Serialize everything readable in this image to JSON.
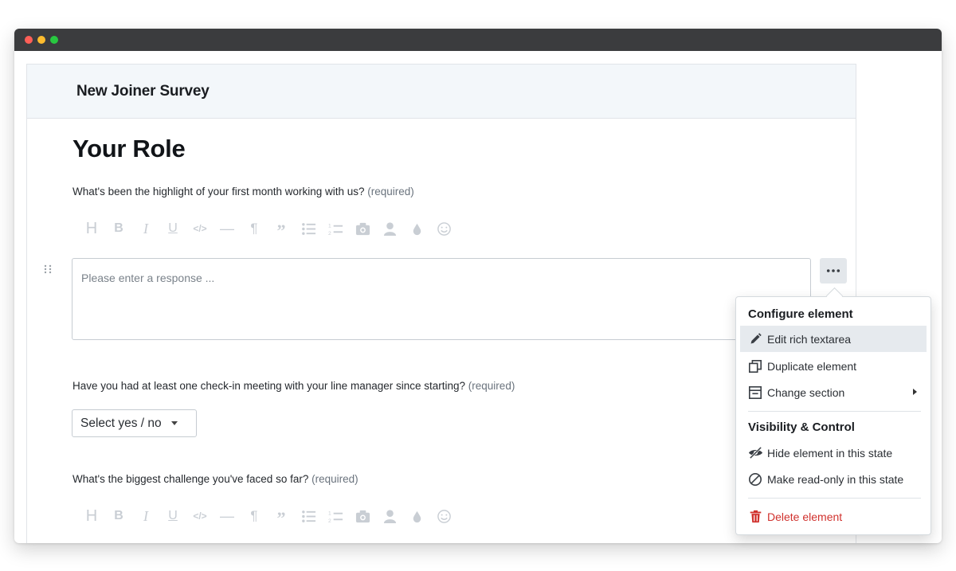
{
  "window": {
    "controls": [
      "close",
      "minimize",
      "maximize"
    ]
  },
  "survey": {
    "title": "New Joiner Survey",
    "section_title": "Your Role",
    "questions": [
      {
        "text": "What's been the highlight of your first month working with us?",
        "required": "(required)",
        "placeholder": "Please enter a response ..."
      },
      {
        "text": "Have you had at least one check-in meeting with your line manager since starting?",
        "required": "(required)",
        "select_value": "Select yes / no"
      },
      {
        "text": "What's the biggest challenge you've faced so far?",
        "required": "(required)"
      }
    ],
    "toolbar_icons": [
      "heading-icon",
      "bold-icon",
      "italic-icon",
      "underline-icon",
      "code-icon",
      "horizontal-rule-icon",
      "paragraph-icon",
      "quote-icon",
      "bullet-list-icon",
      "numbered-list-icon",
      "image-icon",
      "person-icon",
      "color-drop-icon",
      "emoji-icon"
    ]
  },
  "context_menu": {
    "configure_heading": "Configure element",
    "items_configure": [
      {
        "label": "Edit rich textarea",
        "icon": "pencil-icon",
        "active": true
      },
      {
        "label": "Duplicate element",
        "icon": "duplicate-icon"
      },
      {
        "label": "Change section",
        "icon": "section-icon",
        "submenu": true
      }
    ],
    "visibility_heading": "Visibility & Control",
    "items_visibility": [
      {
        "label": "Hide element in this state",
        "icon": "eye-slash-icon"
      },
      {
        "label": "Make read-only in this state",
        "icon": "ban-icon"
      }
    ],
    "delete_label": "Delete element",
    "danger_color": "#d0312d"
  }
}
